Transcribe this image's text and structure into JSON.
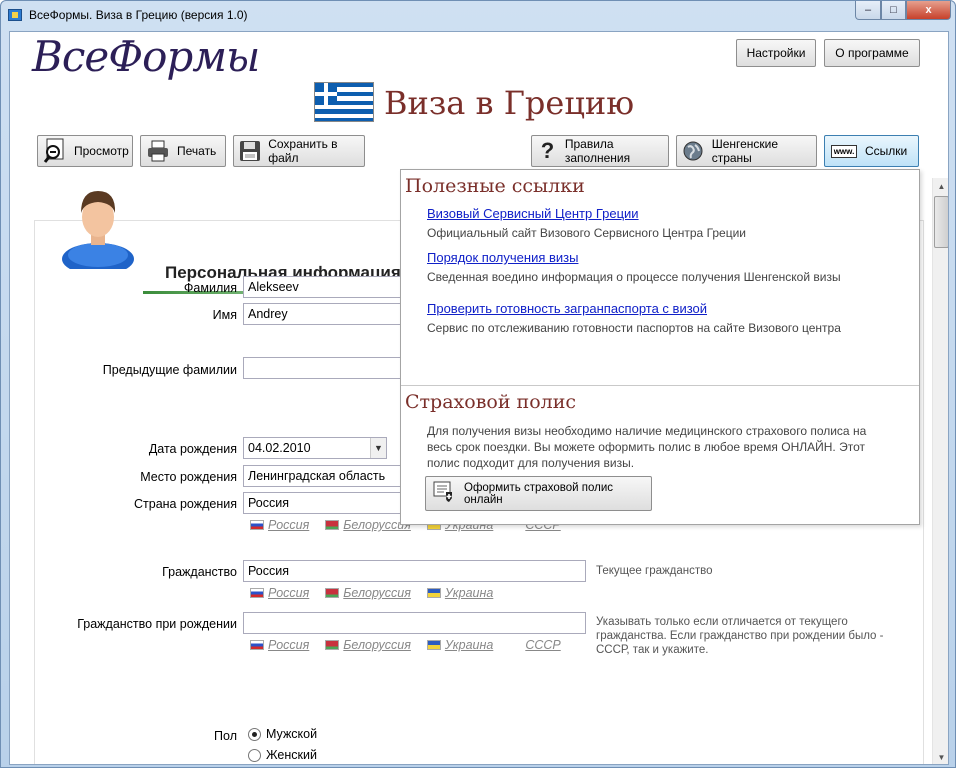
{
  "window": {
    "title": "ВсеФормы. Виза в Грецию (версия 1.0)",
    "controls": {
      "minimize": "–",
      "maximize": "□",
      "close": "x"
    }
  },
  "header": {
    "logo": "ВсеФормы",
    "title": "Виза в Грецию",
    "settings_label": "Настройки",
    "about_label": "О программе"
  },
  "toolbar": {
    "preview_label": "Просмотр",
    "print_label": "Печать",
    "save_label": "Сохранить в файл",
    "rules_label": "Правила заполнения",
    "schengen_label": "Шенгенские страны",
    "links_label": "Ссылки",
    "links_icon_text": "www."
  },
  "form": {
    "section_title": "Персональная информация",
    "surname": {
      "label": "Фамилия",
      "value": "Alekseev"
    },
    "name": {
      "label": "Имя",
      "value": "Andrey"
    },
    "prev_surnames": {
      "label": "Предыдущие фамилии",
      "value": ""
    },
    "birth_date": {
      "label": "Дата рождения",
      "value": "04.02.2010"
    },
    "birth_place": {
      "label": "Место рождения",
      "value": "Ленинградская область"
    },
    "birth_country": {
      "label": "Страна рождения",
      "value": "Россия",
      "quick": [
        "Россия",
        "Белоруссия",
        "Украина",
        "СССР"
      ]
    },
    "citizenship": {
      "label": "Гражданство",
      "value": "Россия",
      "hint": "Текущее гражданство",
      "quick": [
        "Россия",
        "Белоруссия",
        "Украина"
      ]
    },
    "citizenship_birth": {
      "label": "Гражданство при рождении",
      "value": "",
      "hint_lines": [
        "Указывать только если отличается от текущего",
        "гражданства. Если гражданство при рождении было -",
        "СССР, так и укажите."
      ],
      "quick": [
        "Россия",
        "Белоруссия",
        "Украина",
        "СССР"
      ]
    },
    "sex": {
      "label": "Пол",
      "options": [
        "Мужской",
        "Женский"
      ],
      "selected": "Мужской"
    }
  },
  "popup": {
    "links_heading": "Полезные ссылки",
    "links": [
      {
        "title": "Визовый Сервисный Центр Греции ",
        "desc": "Официальный сайт  Визового Сервисного Центра Греции"
      },
      {
        "title": "Порядок получения визы",
        "desc": "Сведенная воедино информация о процессе получения Шенгенской визы"
      },
      {
        "title": "Проверить готовность загранпаспорта с визой",
        "desc": "Сервис по отслеживанию готовности паспортов на сайте Визового центра"
      }
    ],
    "insurance_heading": "Страховой полис",
    "insurance_lines": [
      "Для получения визы необходимо наличие медицинского страхового полиса на",
      "весь срок поездки. Вы можете оформить полис в любое время ОНЛАЙН. Этот",
      "полис подходит для получения визы."
    ],
    "insurance_button": "Оформить страховой полис онлайн"
  }
}
